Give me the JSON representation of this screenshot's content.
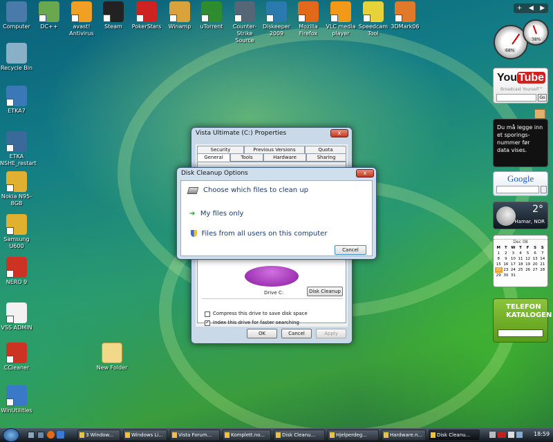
{
  "desktop_top_icons": [
    {
      "label": "Computer",
      "color": "#4a7aaa"
    },
    {
      "label": "DC++",
      "color": "#6aa84f"
    },
    {
      "label": "avast! Antivirus",
      "color": "#f2a024"
    },
    {
      "label": "Steam",
      "color": "#222222"
    },
    {
      "label": "PokerStars",
      "color": "#cc2222"
    },
    {
      "label": "Winamp",
      "color": "#d9a23a"
    },
    {
      "label": "uTorrent",
      "color": "#2e8b2e"
    },
    {
      "label": "Counter-Strike Source",
      "color": "#556677"
    },
    {
      "label": "Diskeeper 2009",
      "color": "#2a7ab0"
    },
    {
      "label": "Mozilla Firefox",
      "color": "#e06a1a"
    },
    {
      "label": "VLC media player",
      "color": "#f29a18"
    },
    {
      "label": "Speedcam Tool",
      "color": "#e7d23a"
    },
    {
      "label": "3DMark06",
      "color": "#e07a2a"
    }
  ],
  "desktop_left_icons": [
    {
      "label": "Recycle Bin",
      "color": "#8ab0c8"
    },
    {
      "label": "ETKA7",
      "color": "#3a78b8"
    },
    {
      "label": "ETKA NSHE_restart",
      "color": "#3a6a9a"
    },
    {
      "label": "Nokia N95-8GB",
      "color": "#e0b030"
    },
    {
      "label": "Samsung U600",
      "color": "#e0b030"
    },
    {
      "label": "NERO 9",
      "color": "#cc3322"
    },
    {
      "label": "VSS ADMIN",
      "color": "#f2f2f2"
    },
    {
      "label": "CCleaner",
      "color": "#cc3322"
    },
    {
      "label": "WinUtilities",
      "color": "#3a78c8"
    }
  ],
  "desktop_folder": {
    "label": "New Folder"
  },
  "sidebar": {
    "ctrl_add": "+",
    "ctrl_left": "◀",
    "ctrl_right": "▶",
    "meter1_value": "68%",
    "meter2_value": "38%",
    "youtube": {
      "logo_you": "You",
      "logo_tube": "Tube",
      "tagline": "Broadcast Yourself™",
      "go": "Go"
    },
    "notice_text": "Du må legge inn et sporings-nummer før data vises.",
    "google": {
      "logo": "Google"
    },
    "weather": {
      "temp": "2°",
      "city": "Hamar, NOR"
    },
    "calendar": {
      "month": "Dec 08",
      "day_headers": [
        "M",
        "T",
        "W",
        "T",
        "F",
        "S",
        "S"
      ],
      "days": [
        "1",
        "2",
        "3",
        "4",
        "5",
        "6",
        "7",
        "8",
        "9",
        "10",
        "11",
        "12",
        "13",
        "14",
        "15",
        "16",
        "17",
        "18",
        "19",
        "20",
        "21",
        "22",
        "23",
        "24",
        "25",
        "26",
        "27",
        "28",
        "29",
        "30",
        "31"
      ],
      "today": "22"
    },
    "telefon": {
      "line1": "TELEFON",
      "line2": "KATALOGEN"
    }
  },
  "properties_window": {
    "title": "Vista Ultimate (C:) Properties",
    "close": "x",
    "tabs_row1": [
      "Security",
      "Previous Versions",
      "Quota"
    ],
    "tabs_row2": [
      "General",
      "Tools",
      "Hardware",
      "Sharing"
    ],
    "drive_label": "Drive C:",
    "disk_cleanup_button": "Disk Cleanup",
    "compress_label": "Compress this drive to save disk space",
    "index_label": "Index this drive for faster searching",
    "ok": "OK",
    "cancel": "Cancel",
    "apply": "Apply"
  },
  "cleanup_dialog": {
    "title": "Disk Cleanup Options",
    "close": "x",
    "heading": "Choose which files to clean up",
    "option1": "My files only",
    "option2": "Files from all users on this computer",
    "cancel": "Cancel"
  },
  "taskbar": {
    "buttons": [
      "3 Window...",
      "Windows Li...",
      "Vista Forum...",
      "Komplett.no...",
      "Disk Cleanu...",
      "Hjelperdeg...",
      "Hardware.n...",
      "Disk Cleanu..."
    ],
    "clock": "18:59"
  }
}
